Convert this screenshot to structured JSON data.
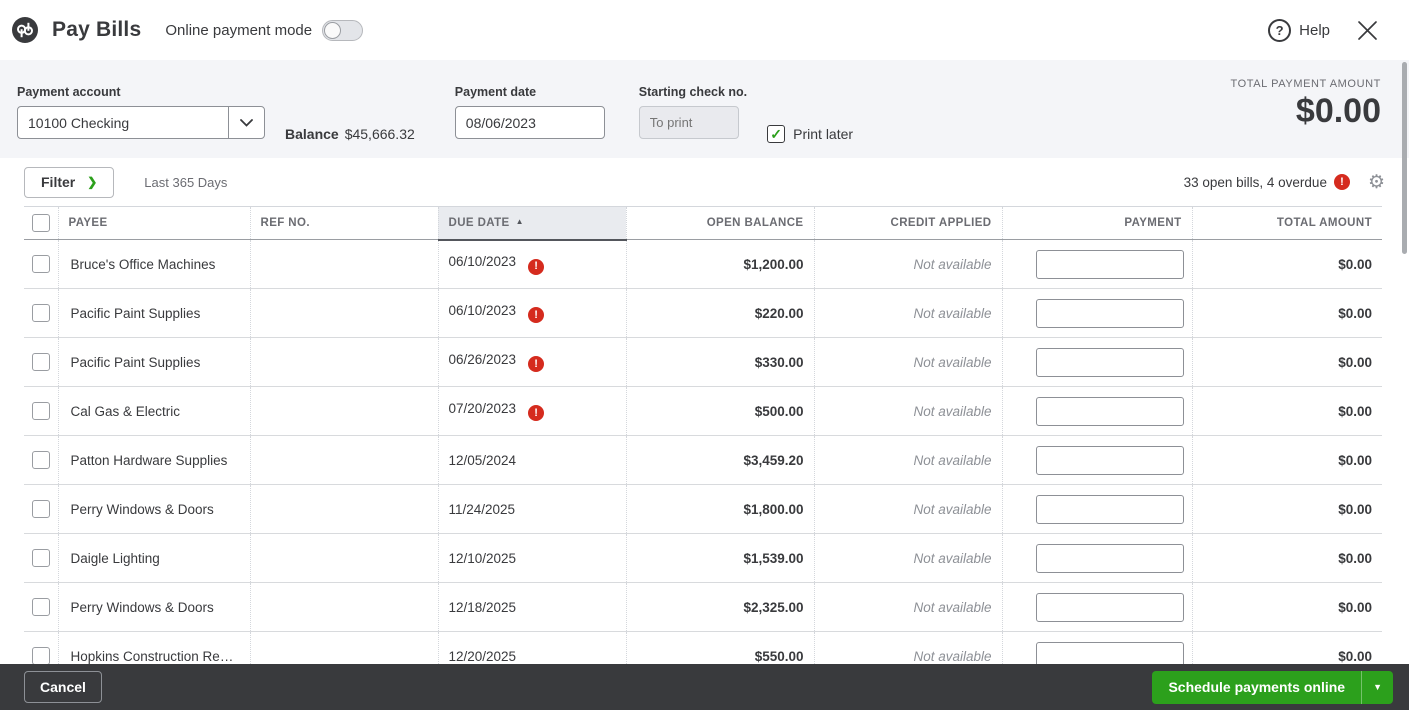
{
  "header": {
    "title": "Pay Bills",
    "online_payment_mode_label": "Online payment mode",
    "online_payment_mode_on": false,
    "help_label": "Help"
  },
  "payment_bar": {
    "account_label": "Payment account",
    "account_value": "10100 Checking",
    "balance_label": "Balance",
    "balance_value": "$45,666.32",
    "date_label": "Payment date",
    "date_value": "08/06/2023",
    "check_label": "Starting check no.",
    "check_placeholder": "To print",
    "print_later_label": "Print later",
    "print_later_checked": true,
    "total_label": "TOTAL PAYMENT AMOUNT",
    "total_value": "$0.00"
  },
  "filter_bar": {
    "filter_label": "Filter",
    "range_label": "Last 365 Days",
    "summary": "33 open bills, 4 overdue"
  },
  "table": {
    "columns": [
      "PAYEE",
      "REF NO.",
      "DUE DATE",
      "OPEN BALANCE",
      "CREDIT APPLIED",
      "PAYMENT",
      "TOTAL AMOUNT"
    ],
    "rows": [
      {
        "payee": "Bruce's Office Machines",
        "ref": "",
        "due_date": "06/10/2023",
        "overdue": true,
        "open_balance": "$1,200.00",
        "credit_applied": "Not available",
        "payment": "",
        "total": "$0.00"
      },
      {
        "payee": "Pacific Paint Supplies",
        "ref": "",
        "due_date": "06/10/2023",
        "overdue": true,
        "open_balance": "$220.00",
        "credit_applied": "Not available",
        "payment": "",
        "total": "$0.00"
      },
      {
        "payee": "Pacific Paint Supplies",
        "ref": "",
        "due_date": "06/26/2023",
        "overdue": true,
        "open_balance": "$330.00",
        "credit_applied": "Not available",
        "payment": "",
        "total": "$0.00"
      },
      {
        "payee": "Cal Gas & Electric",
        "ref": "",
        "due_date": "07/20/2023",
        "overdue": true,
        "open_balance": "$500.00",
        "credit_applied": "Not available",
        "payment": "",
        "total": "$0.00"
      },
      {
        "payee": "Patton Hardware Supplies",
        "ref": "",
        "due_date": "12/05/2024",
        "overdue": false,
        "open_balance": "$3,459.20",
        "credit_applied": "Not available",
        "payment": "",
        "total": "$0.00"
      },
      {
        "payee": "Perry Windows & Doors",
        "ref": "",
        "due_date": "11/24/2025",
        "overdue": false,
        "open_balance": "$1,800.00",
        "credit_applied": "Not available",
        "payment": "",
        "total": "$0.00"
      },
      {
        "payee": "Daigle Lighting",
        "ref": "",
        "due_date": "12/10/2025",
        "overdue": false,
        "open_balance": "$1,539.00",
        "credit_applied": "Not available",
        "payment": "",
        "total": "$0.00"
      },
      {
        "payee": "Perry Windows & Doors",
        "ref": "",
        "due_date": "12/18/2025",
        "overdue": false,
        "open_balance": "$2,325.00",
        "credit_applied": "Not available",
        "payment": "",
        "total": "$0.00"
      },
      {
        "payee": "Hopkins Construction Rent...",
        "ref": "",
        "due_date": "12/20/2025",
        "overdue": false,
        "open_balance": "$550.00",
        "credit_applied": "Not available",
        "payment": "",
        "total": "$0.00"
      }
    ]
  },
  "footer": {
    "cancel_label": "Cancel",
    "schedule_label": "Schedule payments online"
  }
}
